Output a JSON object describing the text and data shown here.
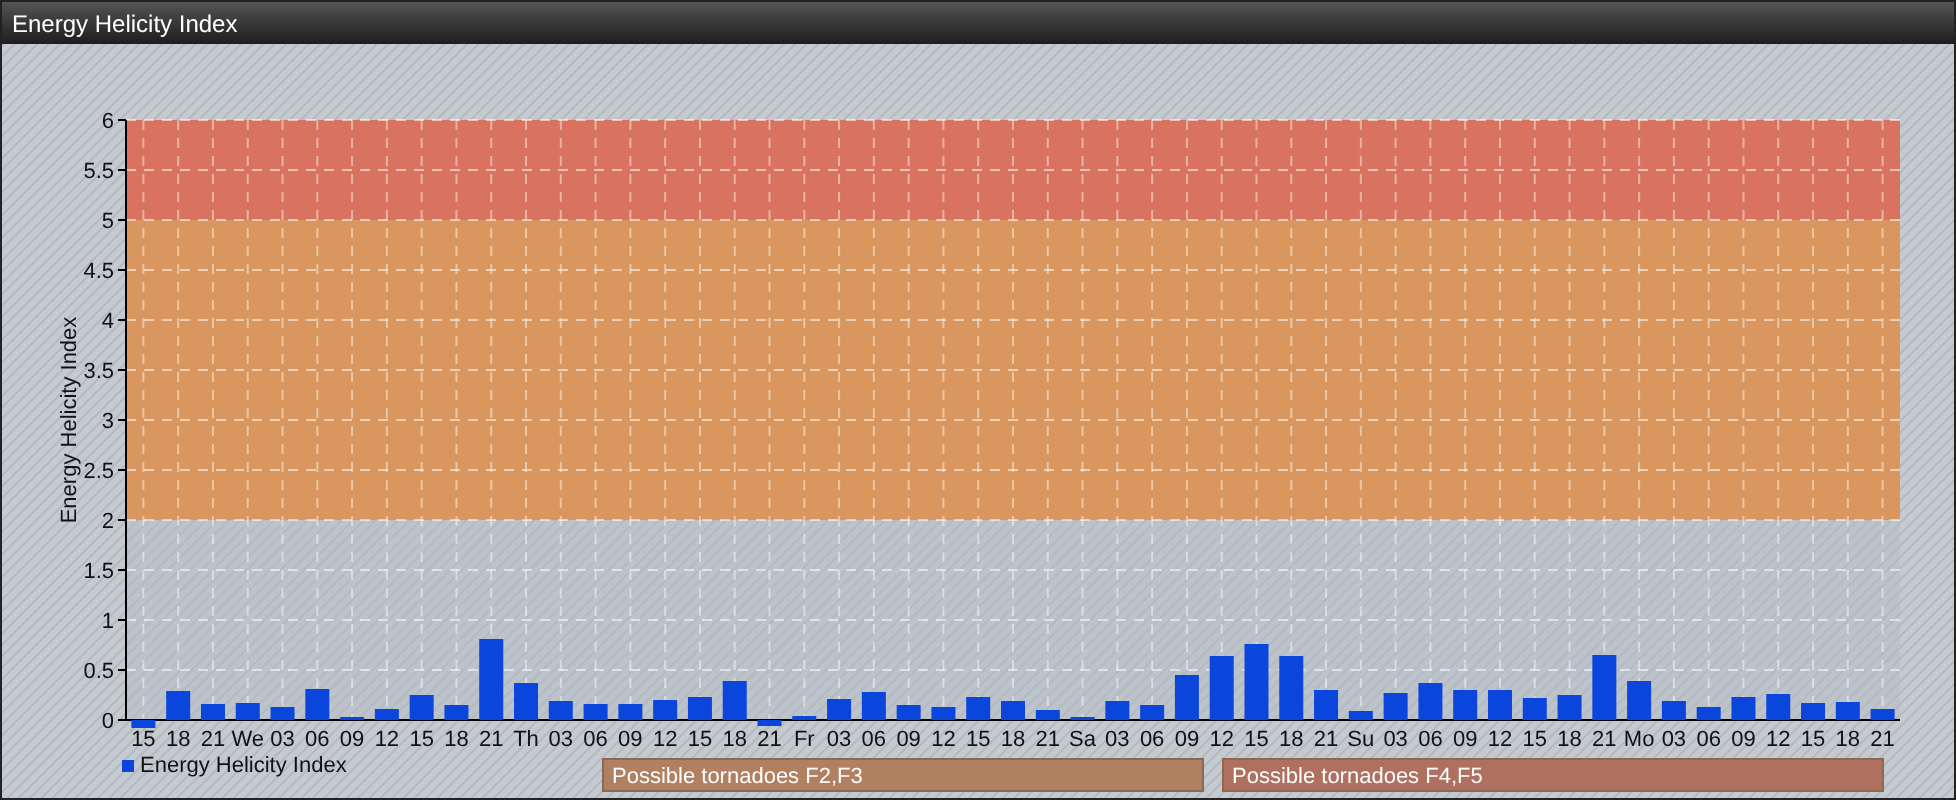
{
  "window": {
    "title": "Energy Helicity Index"
  },
  "chart": {
    "chart_data": {
      "type": "bar",
      "ylabel": "Energy Helicity Index",
      "categories": [
        "15",
        "18",
        "21",
        "We",
        "03",
        "06",
        "09",
        "12",
        "15",
        "18",
        "21",
        "Th",
        "03",
        "06",
        "09",
        "12",
        "15",
        "18",
        "21",
        "Fr",
        "03",
        "06",
        "09",
        "12",
        "15",
        "18",
        "21",
        "Sa",
        "03",
        "06",
        "09",
        "12",
        "15",
        "18",
        "21",
        "Su",
        "03",
        "06",
        "09",
        "12",
        "15",
        "18",
        "21",
        "Mo",
        "03",
        "06",
        "09",
        "12",
        "15",
        "18",
        "21"
      ],
      "series": [
        {
          "name": "Energy Helicity Index",
          "color": "#0a46dc",
          "values": [
            -0.07,
            0.28,
            0.15,
            0.16,
            0.12,
            0.3,
            0.02,
            0.1,
            0.24,
            0.14,
            0.8,
            0.36,
            0.18,
            0.15,
            0.15,
            0.19,
            0.22,
            0.38,
            -0.05,
            0.03,
            0.2,
            0.27,
            0.14,
            0.12,
            0.22,
            0.18,
            0.09,
            0.02,
            0.18,
            0.14,
            0.44,
            0.63,
            0.75,
            0.63,
            0.29,
            0.08,
            0.26,
            0.36,
            0.29,
            0.29,
            0.21,
            0.24,
            0.64,
            0.38,
            0.18,
            0.12,
            0.22,
            0.25,
            0.16,
            0.17,
            0.1
          ]
        }
      ],
      "ylim": [
        -0.1,
        6
      ],
      "grid": true,
      "yticks": [
        0,
        {
          "value": 0.5,
          "label": "0.5"
        },
        1,
        {
          "value": 1.5,
          "label": "1.5"
        },
        2,
        {
          "value": 2.5,
          "label": "2.5"
        },
        3,
        {
          "value": 3.5,
          "label": "3.5"
        },
        4,
        {
          "value": 4.5,
          "label": "4.5"
        },
        5,
        {
          "value": 5.5,
          "label": "5.5"
        },
        6
      ],
      "bands": [
        {
          "axis": "y",
          "from": 2,
          "to": 5,
          "color": "#d9975f"
        },
        {
          "axis": "y",
          "from": 5,
          "to": 6,
          "color": "#d9735f"
        }
      ]
    },
    "band_legend": [
      {
        "label": "Possible tornadoes F2,F3",
        "color": "#b08060"
      },
      {
        "label": "Possible tornadoes F4,F5",
        "color": "#b07060"
      }
    ]
  }
}
